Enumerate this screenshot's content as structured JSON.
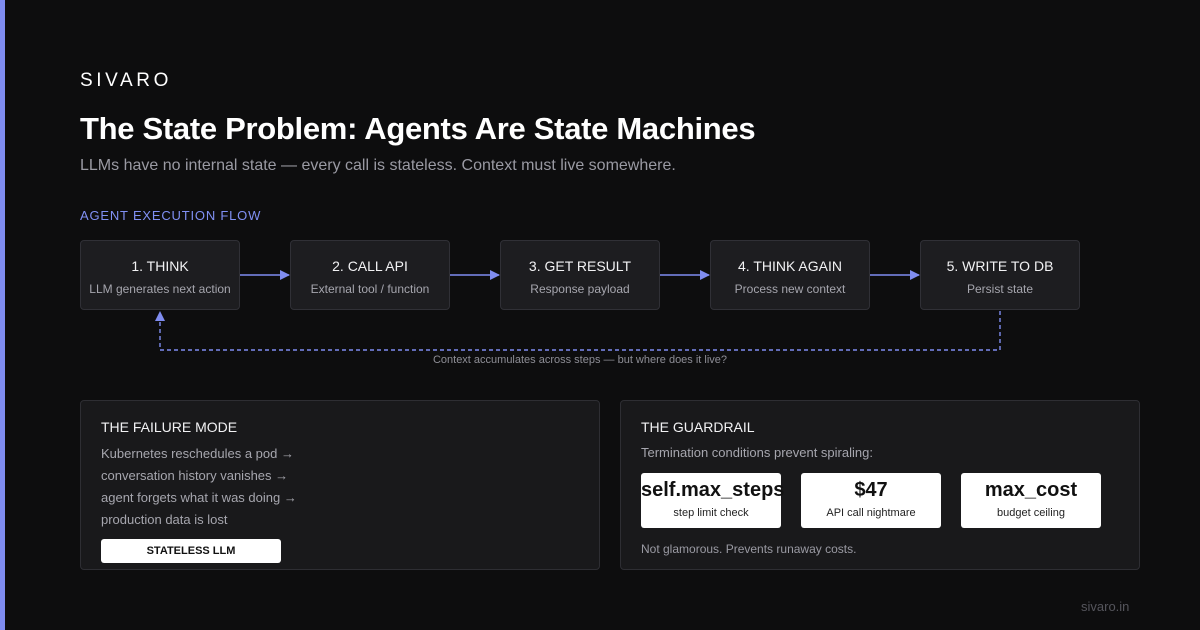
{
  "brand": "SIVARO",
  "title": "The State Problem: Agents Are State Machines",
  "subtitle": "LLMs have no internal state — every call is stateless. Context must live somewhere.",
  "flow": {
    "label": "AGENT EXECUTION FLOW",
    "steps": [
      {
        "title": "1. THINK",
        "desc": "LLM generates next action"
      },
      {
        "title": "2. CALL API",
        "desc": "External tool / function"
      },
      {
        "title": "3. GET RESULT",
        "desc": "Response payload"
      },
      {
        "title": "4. THINK AGAIN",
        "desc": "Process new context"
      },
      {
        "title": "5. WRITE TO DB",
        "desc": "Persist state"
      }
    ],
    "loop_caption": "Context accumulates across steps — but where does it live?"
  },
  "failure": {
    "title": "THE FAILURE MODE",
    "lines": [
      "Kubernetes reschedules a pod →",
      "conversation history vanishes →",
      "agent forgets what it was doing →",
      "production data is lost"
    ],
    "badge": "STATELESS LLM"
  },
  "guardrail": {
    "title": "THE GUARDRAIL",
    "intro": "Termination conditions prevent spiraling:",
    "metrics": [
      {
        "value": "self.max_steps",
        "label": "step limit check"
      },
      {
        "value": "$47",
        "label": "API call nightmare"
      },
      {
        "value": "max_cost",
        "label": "budget ceiling"
      }
    ],
    "footnote": "Not glamorous. Prevents runaway costs."
  },
  "footer": "sivaro.in",
  "colors": {
    "accent": "#7f8cf0",
    "background": "#0d0d0e",
    "card": "#1d1d20"
  }
}
